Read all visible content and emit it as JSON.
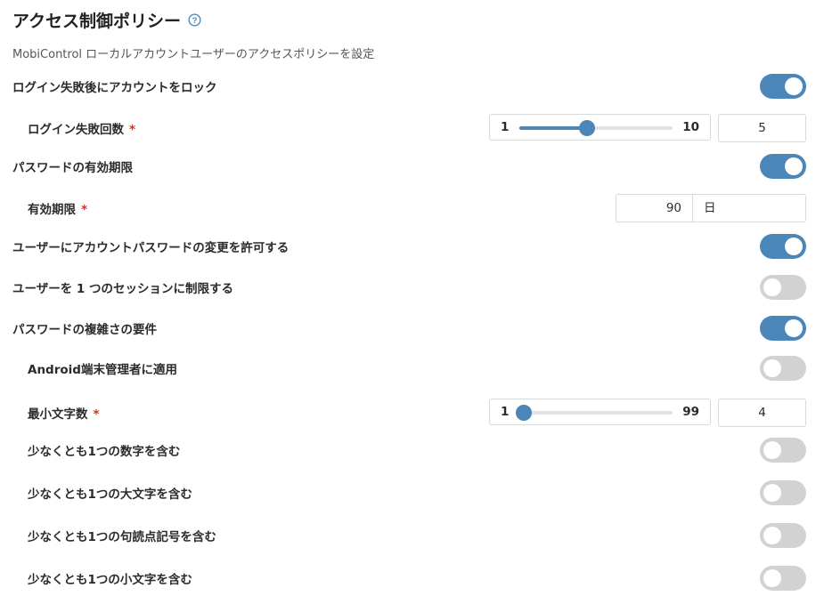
{
  "header": {
    "title": "アクセス制御ポリシー",
    "subtitle": "MobiControl ローカルアカウントユーザーのアクセスポリシーを設定",
    "help_icon": "question-circle-icon"
  },
  "colors": {
    "accent": "#4a86b8",
    "toggle_off": "#d2d2d2",
    "required": "#c0392b"
  },
  "settings": {
    "lockout": {
      "label": "ログイン失敗後にアカウントをロック",
      "enabled": true
    },
    "failed_attempts": {
      "label": "ログイン失敗回数",
      "required_mark": "*",
      "min": "1",
      "max": "10",
      "value": "5",
      "value_num": 5,
      "min_num": 1,
      "max_num": 10
    },
    "password_expiry": {
      "label": "パスワードの有効期限",
      "enabled": true
    },
    "expiry_period": {
      "label": "有効期限",
      "required_mark": "*",
      "value": "90",
      "unit": "日"
    },
    "allow_change": {
      "label": "ユーザーにアカウントパスワードの変更を許可する",
      "enabled": true
    },
    "single_session": {
      "label": "ユーザーを 1 つのセッションに制限する",
      "enabled": false
    },
    "complexity": {
      "label": "パスワードの複雑さの要件",
      "enabled": true
    },
    "android_admin": {
      "label": "Android端末管理者に適用",
      "enabled": false
    },
    "min_length": {
      "label": "最小文字数",
      "required_mark": "*",
      "min": "1",
      "max": "99",
      "value": "4",
      "value_num": 4,
      "min_num": 1,
      "max_num": 99
    },
    "require_number": {
      "label": "少なくとも1つの数字を含む",
      "enabled": false
    },
    "require_upper": {
      "label": "少なくとも1つの大文字を含む",
      "enabled": false
    },
    "require_punct": {
      "label": "少なくとも1つの句読点記号を含む",
      "enabled": false
    },
    "require_lower": {
      "label": "少なくとも1つの小文字を含む",
      "enabled": false
    }
  }
}
